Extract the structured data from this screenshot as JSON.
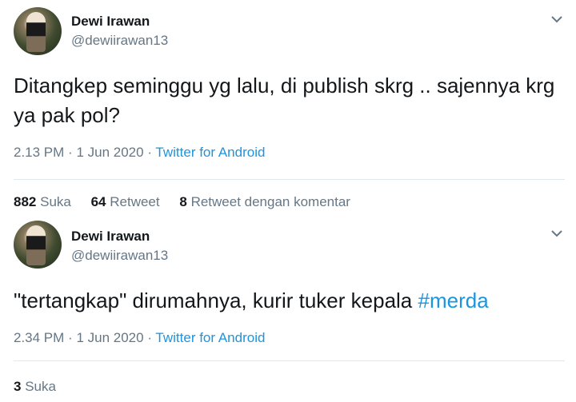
{
  "tweets": [
    {
      "author": {
        "name": "Dewi Irawan",
        "handle": "@dewiirawan13"
      },
      "text": "Ditangkep seminggu yg lalu, di publish skrg .. sajennya krg ya pak pol?",
      "hashtag": "",
      "time": "2.13 PM",
      "date": "1 Jun 2020",
      "separator": "·",
      "app": "Twitter for Android",
      "stats": [
        {
          "count": "882",
          "label": "Suka"
        },
        {
          "count": "64",
          "label": "Retweet"
        },
        {
          "count": "8",
          "label": "Retweet dengan komentar"
        }
      ]
    },
    {
      "author": {
        "name": "Dewi Irawan",
        "handle": "@dewiirawan13"
      },
      "text": "\"tertangkap\" dirumahnya, kurir tuker kepala ",
      "hashtag": "#merda",
      "time": "2.34 PM",
      "date": "1 Jun 2020",
      "separator": "·",
      "app": "Twitter for Android",
      "stats": [
        {
          "count": "3",
          "label": "Suka"
        }
      ]
    }
  ],
  "colors": {
    "link": "#1b95e0",
    "secondary": "#657786",
    "primary": "#14171a",
    "divider": "#e1e8ed"
  },
  "icons": {
    "menu": "chevron-down-icon"
  }
}
